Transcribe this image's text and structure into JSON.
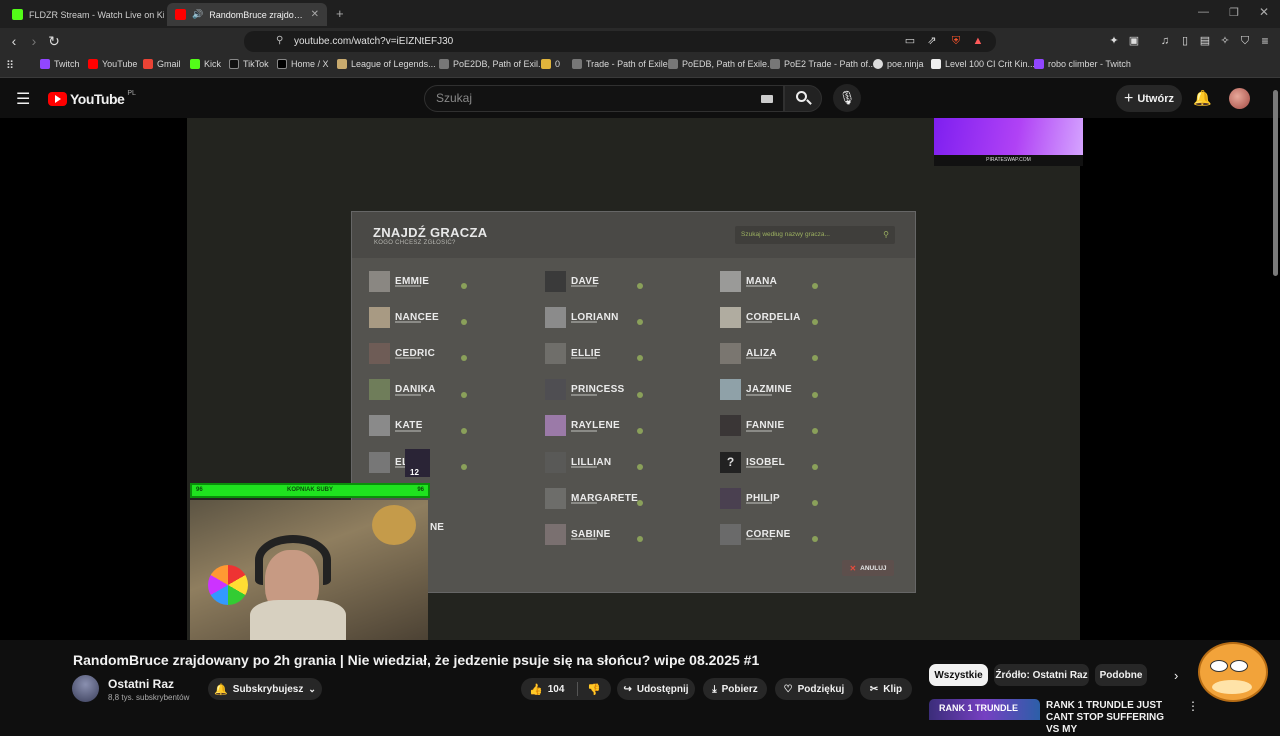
{
  "tabs": [
    {
      "title": "FLDZR Stream - Watch Live on Kick",
      "active": false,
      "color": "#53fc18"
    },
    {
      "title": "RandomBruce zrajdowany po 2h grania | Nie wiedział, że jedzenie psuje się na słońcu?",
      "active": true,
      "color": "#ff0000"
    }
  ],
  "url": "youtube.com/watch?v=iEIZNtEFJ30",
  "bookmarks": [
    "Twitch",
    "YouTube",
    "Gmail",
    "Kick",
    "TikTok",
    "Home / X",
    "League of Legends...",
    "PoE2DB, Path of Exil...",
    "0",
    "Trade - Path of Exile",
    "PoEDB, Path of Exile...",
    "PoE2 Trade - Path of...",
    "poe.ninja",
    "Level 100 CI Crit Kin...",
    "robo climber - Twitch"
  ],
  "yt": {
    "logo": "YouTube",
    "region": "PL",
    "search_placeholder": "Szukaj",
    "create_label": "Utwórz"
  },
  "game": {
    "title": "ZNAJDŹ GRACZA",
    "subtitle": "KOGO CHCESZ ZGŁOSIĆ?",
    "search_placeholder": "Szukaj według nazwy gracza...",
    "cancel_label": "ANULUJ",
    "players": [
      [
        "EMMIE",
        "DAVE",
        "MANA"
      ],
      [
        "NANCEE",
        "LORIANN",
        "CORDELIA"
      ],
      [
        "CEDRIC",
        "ELLIE",
        "ALIZA"
      ],
      [
        "DANIKA",
        "PRINCESS",
        "JAZMINE"
      ],
      [
        "KATE",
        "RAYLENE",
        "FANNIE"
      ],
      [
        "EL",
        "LILLIAN",
        "ISOBEL"
      ],
      [
        "",
        "MARGARETE",
        "PHILIP"
      ],
      [
        "NE",
        "SABINE",
        "CORENE"
      ]
    ],
    "ad_text": "PIRATESWAP.COM",
    "sub_bar_label": "KOPNIAK SUBY",
    "sub_bar_left": "96",
    "sub_bar_right": "96",
    "cursor_badge": "12"
  },
  "video": {
    "title": "RandomBruce zrajdowany po 2h grania | Nie wiedział, że jedzenie psuje się na słońcu? wipe 08.2025 #1",
    "channel": "Ostatni Raz",
    "subscribers": "8,8 tys. subskrybentów",
    "subscribe_label": "Subskrybujesz",
    "likes": "104",
    "share_label": "Udostępnij",
    "download_label": "Pobierz",
    "thanks_label": "Podziękuj",
    "clip_label": "Klip"
  },
  "chips": [
    "Wszystkie",
    "Źródło: Ostatni Raz",
    "Podobne"
  ],
  "recommended": {
    "title": "RANK 1 TRUNDLE JUST CANT STOP SUFFERING VS MY",
    "thumb_text": "RANK 1 TRUNDLE"
  }
}
